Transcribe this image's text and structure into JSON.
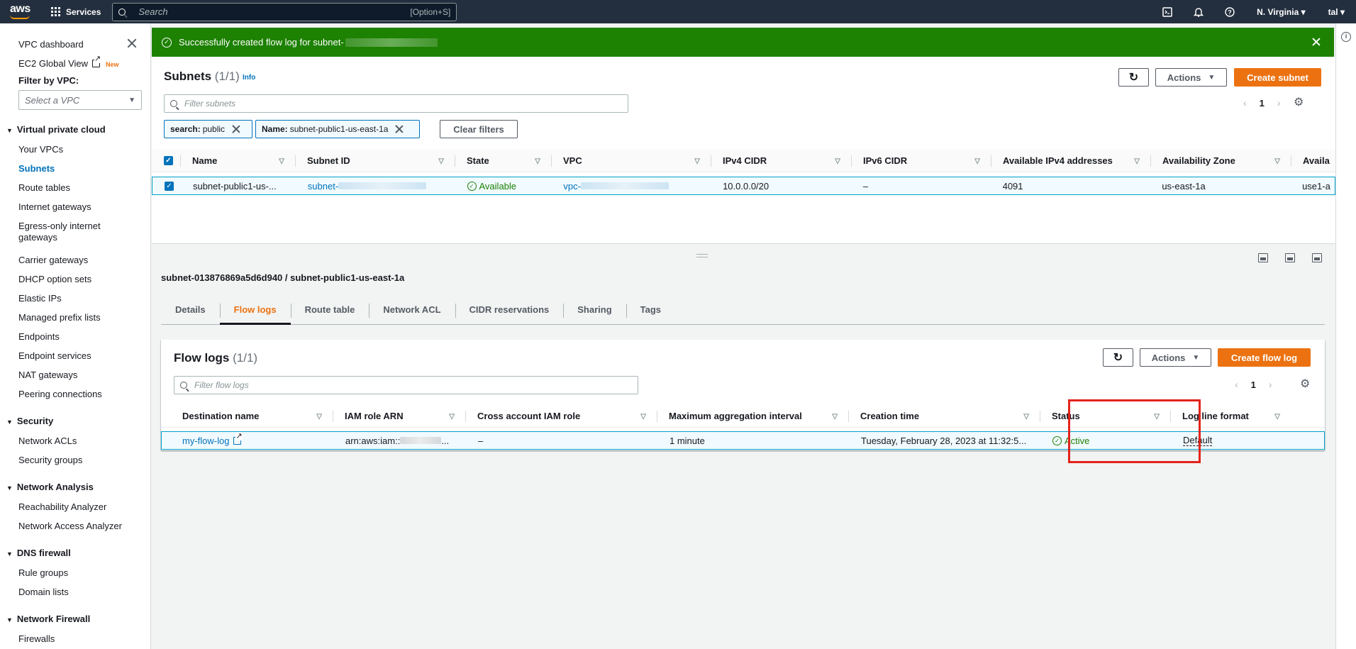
{
  "nav": {
    "logo": "aws",
    "services": "Services",
    "search_placeholder": "Search",
    "search_shortcut": "[Option+S]",
    "region": "N. Virginia",
    "user": "tal",
    "icons": [
      "cloudshell-icon",
      "bell-icon",
      "help-icon"
    ]
  },
  "sidebar": {
    "top_links": [
      "VPC dashboard",
      "EC2 Global View"
    ],
    "new_badge": "New",
    "filter_label": "Filter by VPC:",
    "filter_placeholder": "Select a VPC",
    "sections": [
      {
        "title": "Virtual private cloud",
        "items": [
          "Your VPCs",
          "Subnets",
          "Route tables",
          "Internet gateways",
          "Egress-only internet gateways",
          "Carrier gateways",
          "DHCP option sets",
          "Elastic IPs",
          "Managed prefix lists",
          "Endpoints",
          "Endpoint services",
          "NAT gateways",
          "Peering connections"
        ]
      },
      {
        "title": "Security",
        "items": [
          "Network ACLs",
          "Security groups"
        ]
      },
      {
        "title": "Network Analysis",
        "items": [
          "Reachability Analyzer",
          "Network Access Analyzer"
        ]
      },
      {
        "title": "DNS firewall",
        "items": [
          "Rule groups",
          "Domain lists"
        ]
      },
      {
        "title": "Network Firewall",
        "items": [
          "Firewalls"
        ]
      }
    ],
    "egress_line1": "Egress-only internet",
    "egress_line2": "gateways",
    "active_item": "Subnets"
  },
  "flash": {
    "message": "Successfully created flow log for subnet-"
  },
  "subnets": {
    "title": "Subnets",
    "count": "(1/1)",
    "info": "Info",
    "actions": "Actions",
    "create": "Create subnet",
    "filter_placeholder": "Filter subnets",
    "page": "1",
    "tokens": [
      {
        "key": "search:",
        "value": "public"
      },
      {
        "key": "Name:",
        "value": "subnet-public1-us-east-1a"
      }
    ],
    "clear_filters": "Clear filters",
    "columns": [
      "Name",
      "Subnet ID",
      "State",
      "VPC",
      "IPv4 CIDR",
      "IPv6 CIDR",
      "Available IPv4 addresses",
      "Availability Zone",
      "Availa"
    ],
    "row": {
      "name": "subnet-public1-us-...",
      "subnet_id_prefix": "subnet-",
      "state": "Available",
      "vpc_prefix": "vpc-",
      "ipv4": "10.0.0.0/20",
      "ipv6": "–",
      "available": "4091",
      "az": "us-east-1a",
      "az_id": "use1-a"
    }
  },
  "detail": {
    "title": "subnet-013876869a5d6d940 / subnet-public1-us-east-1a",
    "tabs": [
      "Details",
      "Flow logs",
      "Route table",
      "Network ACL",
      "CIDR reservations",
      "Sharing",
      "Tags"
    ],
    "active_tab": "Flow logs"
  },
  "flow_logs": {
    "title": "Flow logs",
    "count": "(1/1)",
    "actions": "Actions",
    "create": "Create flow log",
    "filter_placeholder": "Filter flow logs",
    "page": "1",
    "columns": [
      "Destination name",
      "IAM role ARN",
      "Cross account IAM role",
      "Maximum aggregation interval",
      "Creation time",
      "Status",
      "Log line format"
    ],
    "row": {
      "destination": "my-flow-log",
      "iam_prefix": "arn:aws:iam::",
      "iam_suffix": "...",
      "cross_account": "–",
      "interval": "1 minute",
      "created": "Tuesday, February 28, 2023 at 11:32:5...",
      "status": "Active",
      "format": "Default"
    }
  },
  "colors": {
    "nav_bg": "#232f3e",
    "flash_bg": "#1d8102",
    "primary": "#ec7211",
    "link": "#0073bb",
    "highlight": "#e3231a"
  }
}
